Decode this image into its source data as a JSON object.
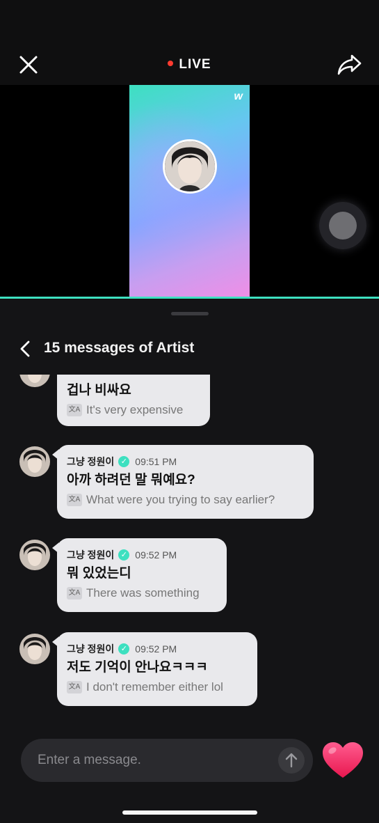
{
  "header": {
    "live_label": "LIVE",
    "live_dot_color": "#ff3b30",
    "close_icon": "close-icon",
    "share_icon": "share-icon"
  },
  "video": {
    "brand_logo": "w",
    "progress_color": "#3de0c0"
  },
  "sheet": {
    "title": "15 messages of Artist",
    "back_icon": "chevron-left-icon"
  },
  "messages": [
    {
      "name": "",
      "time": "",
      "text": "겁나 비싸요",
      "translation": "It's very expensive"
    },
    {
      "name": "그냥 정원이",
      "time": "09:51 PM",
      "text": "아까 하려던 말 뭐예요?",
      "translation": "What were you trying to say earlier?"
    },
    {
      "name": "그냥 정원이",
      "time": "09:52 PM",
      "text": "뭐 있었는디",
      "translation": "There was something"
    },
    {
      "name": "그냥 정원이",
      "time": "09:52 PM",
      "text": "저도 기억이 안나요ㅋㅋㅋ",
      "translation": "I don't remember either lol"
    }
  ],
  "composer": {
    "placeholder": "Enter a message.",
    "send_icon": "arrow-up-icon",
    "heart_icon": "heart-icon",
    "heart_color": "#ff2d6f"
  }
}
